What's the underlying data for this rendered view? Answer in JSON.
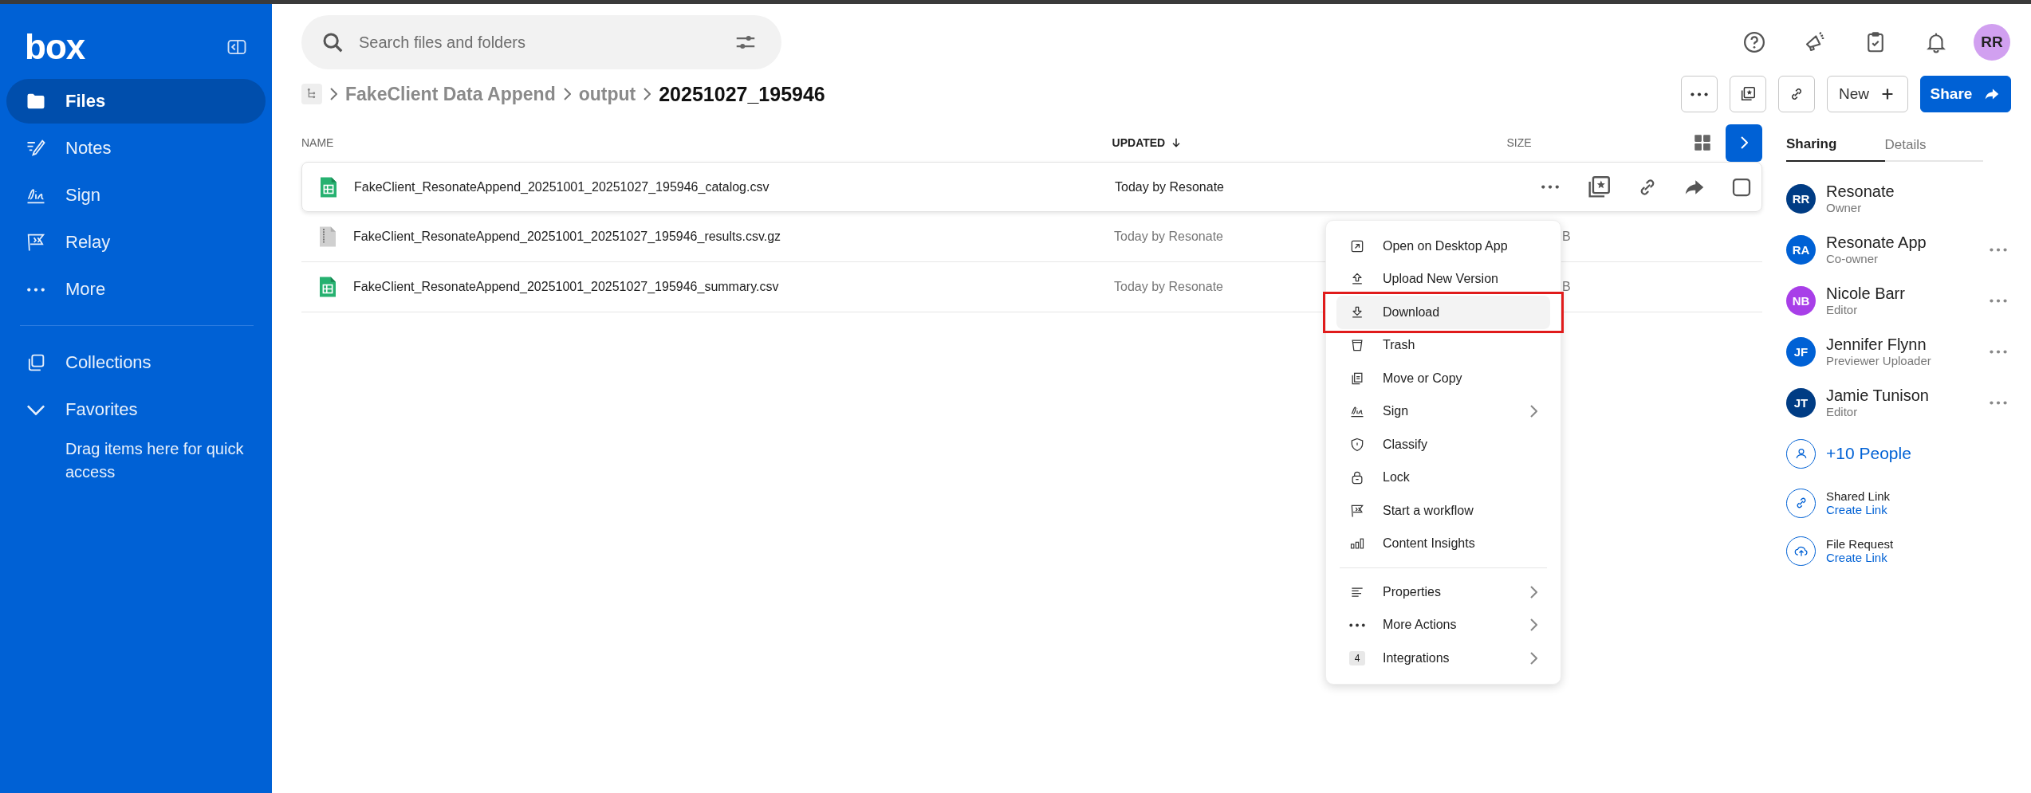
{
  "sidebar": {
    "logo": "box",
    "items": [
      {
        "label": "Files",
        "kind": "folder",
        "selected": true
      },
      {
        "label": "Notes",
        "kind": "notes",
        "selected": false
      },
      {
        "label": "Sign",
        "kind": "sign",
        "selected": false
      },
      {
        "label": "Relay",
        "kind": "flag",
        "selected": false
      },
      {
        "label": "More",
        "kind": "dots",
        "selected": false
      }
    ],
    "collections": {
      "label": "Collections"
    },
    "favorites": {
      "label": "Favorites",
      "expanded": true,
      "hint": "Drag items here for quick access"
    }
  },
  "search": {
    "placeholder": "Search files and folders"
  },
  "account": {
    "initials": "RR"
  },
  "breadcrumb": [
    {
      "label": "FakeClient Data Append",
      "current": false
    },
    {
      "label": "output",
      "current": false
    },
    {
      "label": "20251027_195946",
      "current": true
    }
  ],
  "toolbar": {
    "new_label": "New",
    "share_label": "Share"
  },
  "table": {
    "columns": [
      {
        "label": "NAME",
        "sorted": false
      },
      {
        "label": "UPDATED",
        "sorted": true
      },
      {
        "label": "SIZE",
        "sorted": false
      }
    ],
    "rows": [
      {
        "name": "FakeClient_ResonateAppend_20251001_20251027_195946_catalog.csv",
        "kind": "sheet",
        "updated": "Today by Resonate",
        "hovered": true
      },
      {
        "name": "FakeClient_ResonateAppend_20251001_20251027_195946_results.csv.gz",
        "kind": "archive",
        "updated": "Today by Resonate",
        "size": "B",
        "hovered": false
      },
      {
        "name": "FakeClient_ResonateAppend_20251001_20251027_195946_summary.csv",
        "kind": "sheet",
        "updated": "Today by Resonate",
        "size": "B",
        "hovered": false
      }
    ]
  },
  "context_menu": {
    "sections": [
      [
        {
          "label": "Open on Desktop App",
          "kind": "open",
          "submenu": false,
          "hovered": false,
          "outlined": false
        },
        {
          "label": "Upload New Version",
          "kind": "upload",
          "submenu": false,
          "hovered": false,
          "outlined": false
        },
        {
          "label": "Download",
          "kind": "download",
          "submenu": false,
          "hovered": true,
          "outlined": true
        },
        {
          "label": "Trash",
          "kind": "trash",
          "submenu": false,
          "hovered": false,
          "outlined": false
        },
        {
          "label": "Move or Copy",
          "kind": "copy",
          "submenu": false,
          "hovered": false,
          "outlined": false
        },
        {
          "label": "Sign",
          "kind": "sign",
          "submenu": true,
          "hovered": false,
          "outlined": false
        },
        {
          "label": "Classify",
          "kind": "shield",
          "submenu": false,
          "hovered": false,
          "outlined": false
        },
        {
          "label": "Lock",
          "kind": "lock",
          "submenu": false,
          "hovered": false,
          "outlined": false
        },
        {
          "label": "Start a workflow",
          "kind": "flag",
          "submenu": false,
          "hovered": false,
          "outlined": false
        },
        {
          "label": "Content Insights",
          "kind": "bars",
          "submenu": false,
          "hovered": false,
          "outlined": false
        }
      ],
      [
        {
          "label": "Properties",
          "kind": "lines",
          "submenu": true,
          "hovered": false,
          "outlined": false
        },
        {
          "label": "More Actions",
          "kind": "dots",
          "submenu": true,
          "hovered": false,
          "outlined": false
        },
        {
          "label": "Integrations",
          "kind": "badge",
          "badge": "4",
          "submenu": true,
          "hovered": false,
          "outlined": false
        }
      ]
    ]
  },
  "panel": {
    "tabs": [
      {
        "label": "Sharing",
        "selected": true
      },
      {
        "label": "Details",
        "selected": false
      }
    ],
    "people": [
      {
        "initials": "RR",
        "name": "Resonate",
        "role": "Owner",
        "color": "#003c84",
        "menu": false
      },
      {
        "initials": "RA",
        "name": "Resonate App",
        "role": "Co-owner",
        "color": "#0061d5",
        "menu": true
      },
      {
        "initials": "NB",
        "name": "Nicole Barr",
        "role": "Editor",
        "color": "#a83fe8",
        "menu": true
      },
      {
        "initials": "JF",
        "name": "Jennifer Flynn",
        "role": "Previewer Uploader",
        "color": "#0061d5",
        "menu": true
      },
      {
        "initials": "JT",
        "name": "Jamie Tunison",
        "role": "Editor",
        "color": "#003c84",
        "menu": true
      }
    ],
    "more_people": "+10 People",
    "links": [
      {
        "kind": "link",
        "title": "Shared Link",
        "action": "Create Link"
      },
      {
        "kind": "upload",
        "title": "File Request",
        "action": "Create Link"
      }
    ]
  }
}
